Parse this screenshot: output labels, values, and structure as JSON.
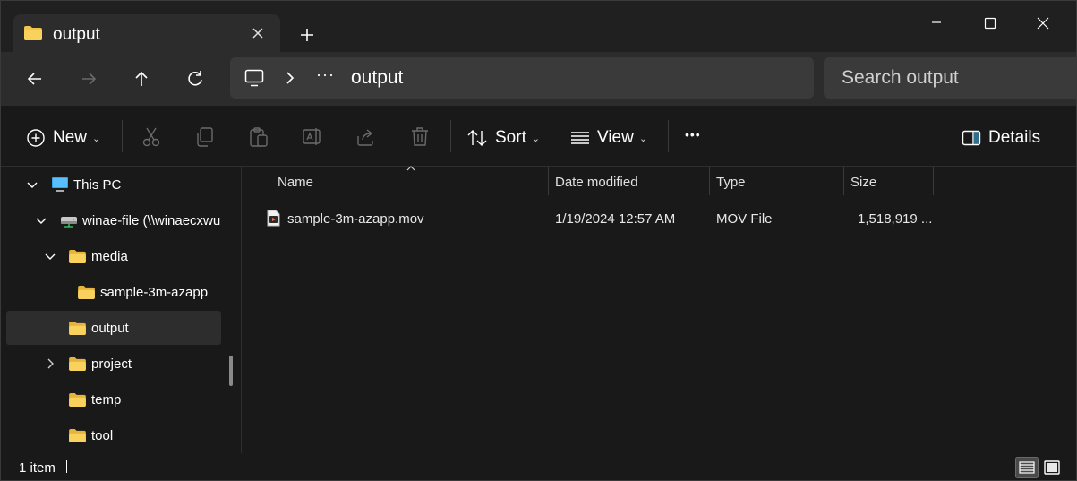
{
  "tab": {
    "title": "output",
    "close_label": "×",
    "new_tab_label": "+"
  },
  "address": {
    "dots": "···",
    "current": "output"
  },
  "search": {
    "placeholder": "Search output"
  },
  "commands": {
    "new_label": "New",
    "sort_label": "Sort",
    "view_label": "View",
    "more_label": "•••",
    "details_label": "Details"
  },
  "sidebar": {
    "items": [
      {
        "label": "This PC"
      },
      {
        "label": "winae-file (\\\\winaecxwu"
      },
      {
        "label": "media"
      },
      {
        "label": "sample-3m-azapp"
      },
      {
        "label": "output"
      },
      {
        "label": "project"
      },
      {
        "label": "temp"
      },
      {
        "label": "tool"
      }
    ]
  },
  "columns": {
    "name": "Name",
    "date": "Date modified",
    "type": "Type",
    "size": "Size"
  },
  "files": [
    {
      "name": "sample-3m-azapp.mov",
      "date": "1/19/2024 12:57 AM",
      "type": "MOV File",
      "size": "1,518,919 ..."
    }
  ],
  "status": {
    "count": "1 item"
  },
  "colors": {
    "folder": "#f3c34a",
    "accent": "#4cc2ff"
  }
}
